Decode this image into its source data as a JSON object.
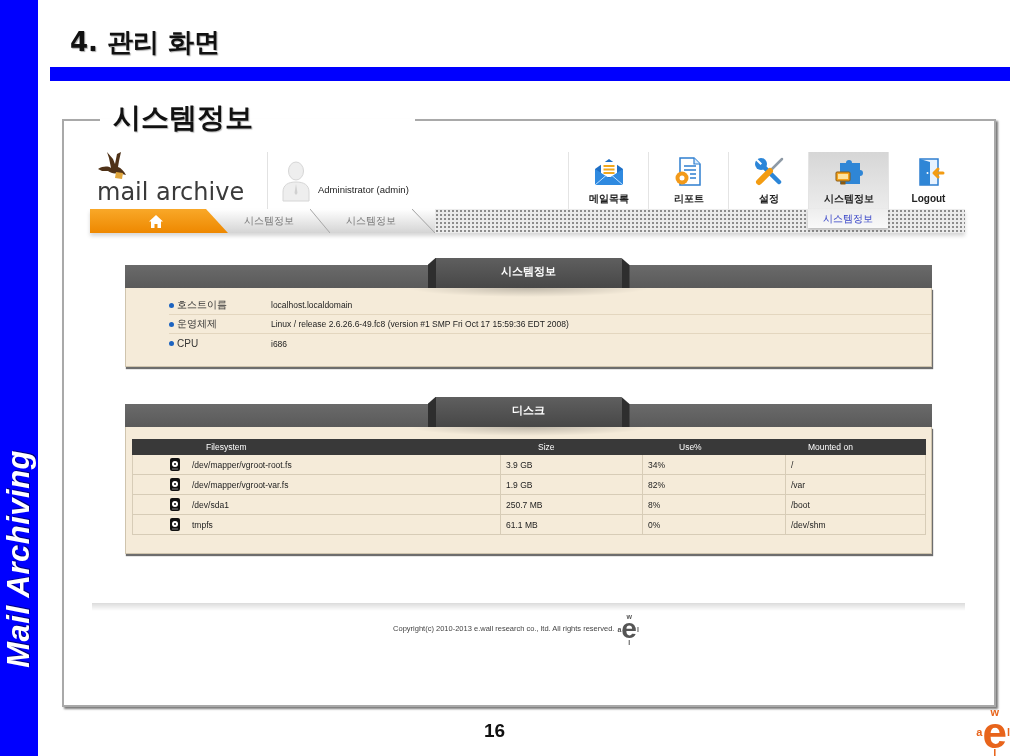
{
  "slide": {
    "side_label": "Mail Archiving",
    "title": "4. 관리 화면",
    "section_title": "시스템정보",
    "page_number": "16",
    "logo": {
      "top": "w",
      "left": "a",
      "center": "e",
      "right": "l",
      "bottom": "l"
    }
  },
  "app": {
    "brand": "mail archive",
    "user": "Administrator (admin)",
    "nav": [
      {
        "kind": "mail",
        "label": "메일목록",
        "selected": false
      },
      {
        "kind": "report",
        "label": "리포트",
        "selected": false
      },
      {
        "kind": "settings",
        "label": "설정",
        "selected": false
      },
      {
        "kind": "sysinfo",
        "label": "시스템정보",
        "selected": true,
        "submenu": [
          "시스템정보"
        ]
      },
      {
        "kind": "logout",
        "label": "Logout",
        "selected": false
      }
    ],
    "breadcrumb": [
      "시스템정보",
      "시스템정보"
    ],
    "system_panel": {
      "title": "시스템정보",
      "rows": [
        {
          "label": "호스트이름",
          "value": "localhost.localdomain"
        },
        {
          "label": "운영체제",
          "value": "Linux / release 2.6.26.6-49.fc8 (version #1 SMP Fri Oct 17 15:59:36 EDT 2008)"
        },
        {
          "label": "CPU",
          "value": "i686"
        }
      ]
    },
    "disk_panel": {
      "title": "디스크",
      "columns": [
        "Filesystem",
        "Size",
        "Use%",
        "Mounted on"
      ],
      "rows": [
        [
          "/dev/mapper/vgroot-root.fs",
          "3.9 GB",
          "34%",
          "/"
        ],
        [
          "/dev/mapper/vgroot-var.fs",
          "1.9 GB",
          "82%",
          "/var"
        ],
        [
          "/dev/sda1",
          "250.7 MB",
          "8%",
          "/boot"
        ],
        [
          "tmpfs",
          "61.1 MB",
          "0%",
          "/dev/shm"
        ]
      ]
    },
    "footer": {
      "copyright": "Copyright(c) 2010-2013 e.wall research co., ltd. All rights reserved.",
      "logo": {
        "top": "w",
        "left": "a",
        "center": "e",
        "right": "l",
        "bottom": "l"
      }
    }
  }
}
